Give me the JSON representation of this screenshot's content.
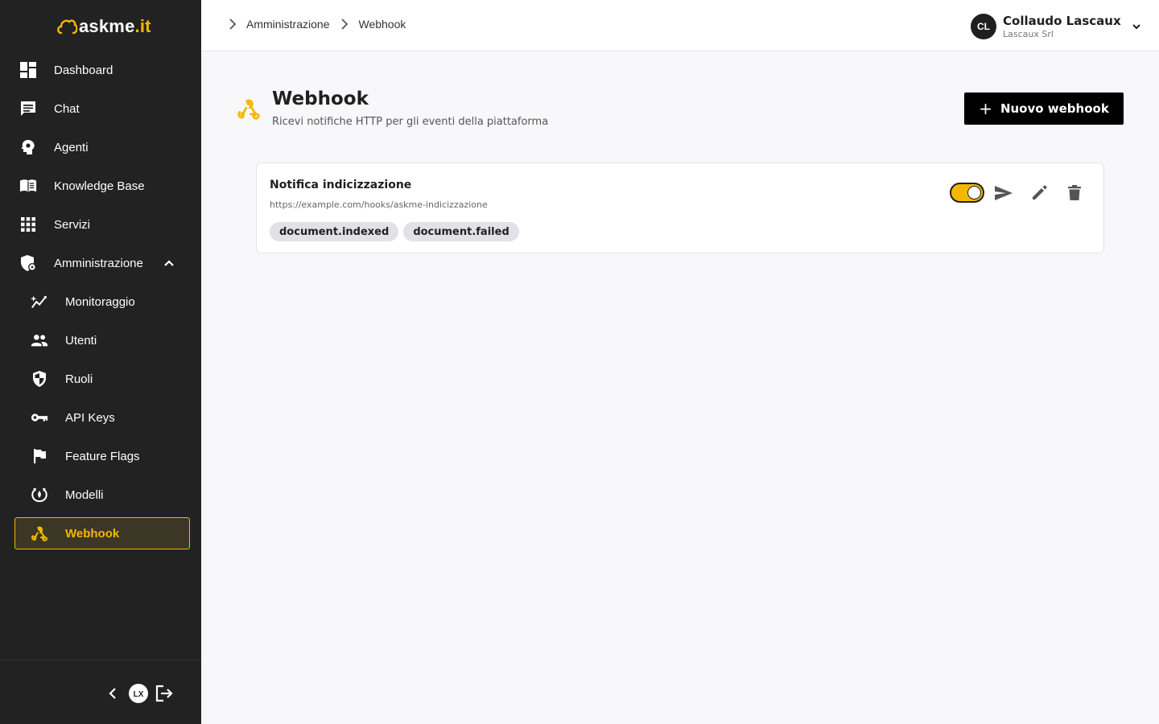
{
  "brand": {
    "name_main": "askme",
    "name_dot": ".it",
    "accent": "#f5b800"
  },
  "sidebar": {
    "items": [
      {
        "label": "Dashboard",
        "icon": "dashboard-icon"
      },
      {
        "label": "Chat",
        "icon": "chat-icon"
      },
      {
        "label": "Agenti",
        "icon": "agent-head-icon"
      },
      {
        "label": "Knowledge Base",
        "icon": "book-icon"
      },
      {
        "label": "Servizi",
        "icon": "grid-icon"
      },
      {
        "label": "Amministrazione",
        "icon": "admin-shield-icon",
        "expanded": true
      }
    ],
    "subitems": [
      {
        "label": "Monitoraggio",
        "icon": "monitoring-icon"
      },
      {
        "label": "Utenti",
        "icon": "users-icon"
      },
      {
        "label": "Ruoli",
        "icon": "shield-icon"
      },
      {
        "label": "API Keys",
        "icon": "key-icon"
      },
      {
        "label": "Feature Flags",
        "icon": "flag-icon"
      },
      {
        "label": "Modelli",
        "icon": "model-icon"
      },
      {
        "label": "Webhook",
        "icon": "webhook-icon",
        "active": true
      }
    ],
    "footer": {
      "badge": "LX"
    }
  },
  "breadcrumb": [
    "Amministrazione",
    "Webhook"
  ],
  "user": {
    "initials": "CL",
    "name": "Collaudo Lascaux",
    "org": "Lascaux Srl"
  },
  "page": {
    "title": "Webhook",
    "subtitle": "Ricevi notifiche HTTP per gli eventi della piattaforma",
    "new_button": "Nuovo webhook"
  },
  "webhooks": [
    {
      "name": "Notifica indicizzazione",
      "url": "https://example.com/hooks/askme-indicizzazione",
      "events": [
        "document.indexed",
        "document.failed"
      ],
      "enabled": true
    }
  ]
}
